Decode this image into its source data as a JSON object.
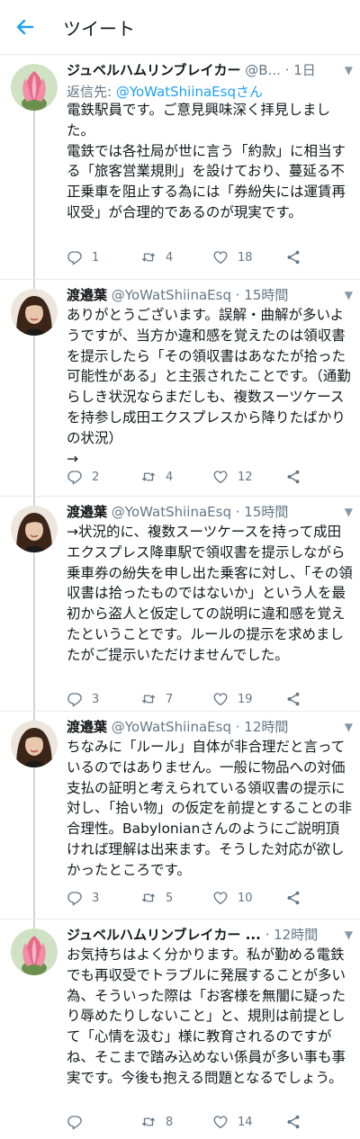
{
  "header": {
    "title": "ツイート"
  },
  "tweets": [
    {
      "name": "ジュベルハムリンブレイカー",
      "handle": "@B...",
      "time": "1日",
      "reply_label": "返信先: ",
      "reply_handle": "@YoWatShiinaEsqさん",
      "body": "電鉄駅員です。ご意見興味深く拝見しました。\n電鉄では各社局が世に言う「約款」に相当する「旅客営業規則」を設けており、蔓延る不正乗車を阻止する為には「券紛失には運賃再収受」が合理的であるのが現実です。",
      "replies": "1",
      "retweets": "4",
      "likes": "18",
      "avatar": "protea-flower"
    },
    {
      "name": "渡邉葉",
      "handle": "@YoWatShiinaEsq",
      "time": "15時間",
      "body": "ありがとうございます。誤解・曲解が多いようですが、当方か違和感を覚えたのは領収書を提示したら「その領収書はあなたが拾った可能性がある」と主張されたことです。（通勤らしき状況ならまだしも、複数スーツケースを持参し成田エクスプレスから降りたばかりの状況）\n→",
      "replies": "2",
      "retweets": "4",
      "likes": "12",
      "avatar": "woman-portrait"
    },
    {
      "name": "渡邉葉",
      "handle": "@YoWatShiinaEsq",
      "time": "15時間",
      "body": "→状況的に、複数スーツケースを持って成田エクスプレス降車駅で領収書を提示しながら乗車券の紛失を申し出た乗客に対し、「その領収書は拾ったものではないか」という人を最初から盗人と仮定しての説明に違和感を覚えたということです。ルールの提示を求めましたがご提示いただけませんでした。",
      "replies": "3",
      "retweets": "7",
      "likes": "19",
      "avatar": "woman-portrait"
    },
    {
      "name": "渡邉葉",
      "handle": "@YoWatShiinaEsq",
      "time": "12時間",
      "body": "ちなみに「ルール」自体が非合理だと言っているのではありません。一般に物品への対価支払の証明と考えられている領収書の提示に対し、「拾い物」の仮定を前提とすることの非合理性。Babylonianさんのようにご説明頂ければ理解は出来ます。そうした対応が欲しかったところです。",
      "replies": "3",
      "retweets": "5",
      "likes": "10",
      "avatar": "woman-portrait"
    },
    {
      "name": "ジュベルハムリンブレイカー ...",
      "handle": "",
      "time": "12時間",
      "body": "お気持ちはよく分かります。私が勤める電鉄でも再収受でトラブルに発展することが多い為、そういった際は「お客様を無闇に疑ったり辱めたりしないこと」と、規則は前提として「心情を汲む」様に教育されるのですがね、そこまで踏み込めない係員が多い事も事実です。今後も抱える問題となるでしょう。",
      "replies": "",
      "retweets": "8",
      "likes": "14",
      "avatar": "protea-flower"
    }
  ],
  "icons": {
    "back": "back-arrow-icon",
    "reply": "reply-icon",
    "retweet": "retweet-icon",
    "like": "heart-icon",
    "share": "share-icon",
    "chevron": "chevron-down-icon"
  },
  "colors": {
    "accent": "#1da1f2",
    "muted": "#657786",
    "divider": "#e6ecf0"
  }
}
